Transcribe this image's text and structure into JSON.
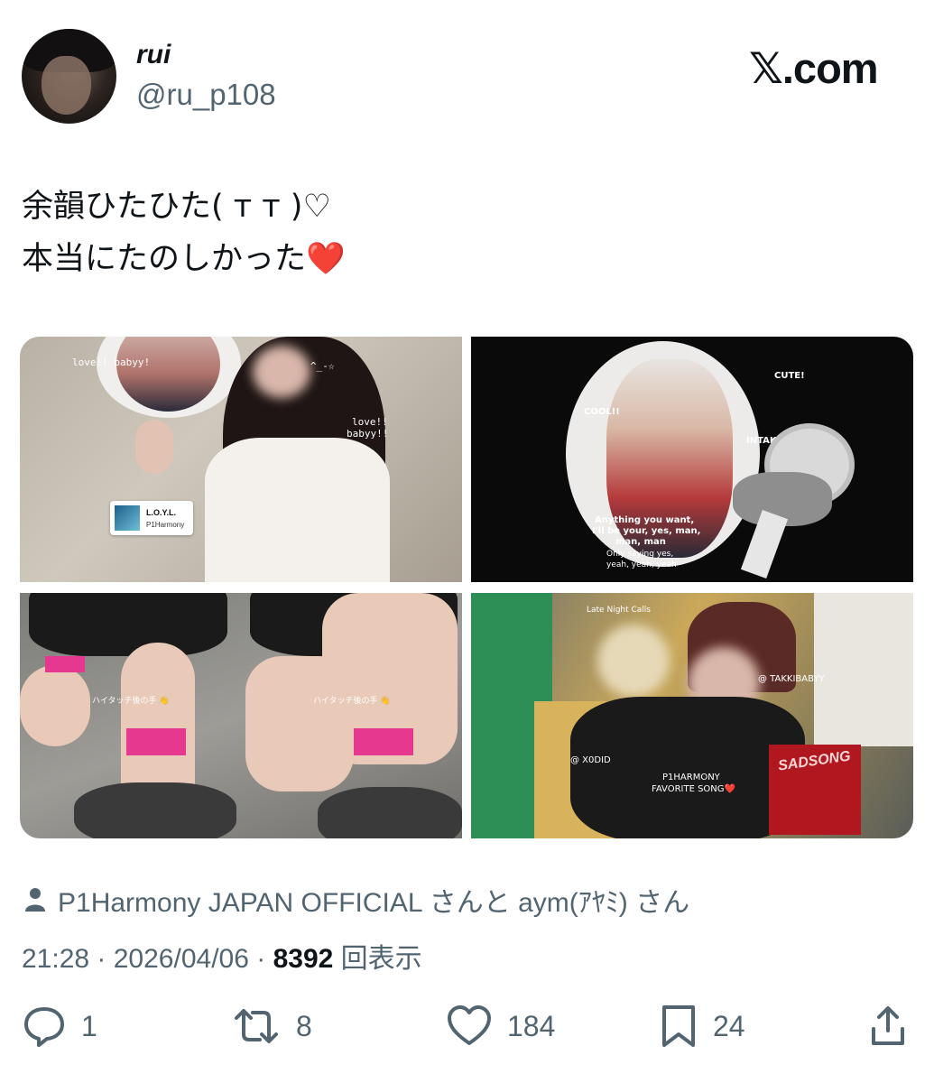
{
  "author": {
    "display_name": "rui",
    "handle": "@ru_p108"
  },
  "brand": {
    "logo_glyph": "𝕏",
    "logo_text": ".com"
  },
  "tweet": {
    "line1": "余韻ひたひた( ᴛ ᴛ )♡",
    "line2": "本当にたのしかった",
    "line2_emoji": "❤️"
  },
  "media": {
    "tile1": {
      "text_love_left": "love!! babyy!",
      "text_love_right_1": "love!!",
      "text_love_right_2": "babyy!!",
      "text_face": "^_-☆",
      "song_title": "L.O.Y.L.",
      "song_artist": "P1Harmony"
    },
    "tile2": {
      "text_cool": "COOL!!",
      "text_cute": "CUTE!",
      "text_intak": "INTAK!!!!",
      "lyric_1": "Anything you want,",
      "lyric_2": "I'll be your, yes, man,",
      "lyric_3": "man, man",
      "lyric_4": "Only saying yes,",
      "lyric_5": "yeah, yeah, yeah"
    },
    "tile3": {
      "caption_left": "ハイタッチ後の手 👋",
      "caption_right": "ハイタッチ後の手 👋"
    },
    "tile4": {
      "top_label": "Late Night Calls",
      "handle_right": "@ TAKKIBABYY",
      "handle_left": "@ X0DID",
      "caption_1": "P1HARMONY",
      "caption_2": "FAVORITE SONG❤️",
      "album_text": "SADSONG"
    }
  },
  "tags": {
    "text": "P1Harmony JAPAN OFFICIAL さんと aym(ｱﾔﾐ) さん"
  },
  "meta": {
    "time": "21:28",
    "sep1": " · ",
    "date": "2026/04/06",
    "sep2": " · ",
    "views": "8392",
    "views_label": " 回表示"
  },
  "actions": {
    "replies": "1",
    "reposts": "8",
    "likes": "184",
    "bookmarks": "24"
  },
  "colors": {
    "text_primary": "#0f1419",
    "text_secondary": "#536471",
    "heart": "#e0283a"
  }
}
